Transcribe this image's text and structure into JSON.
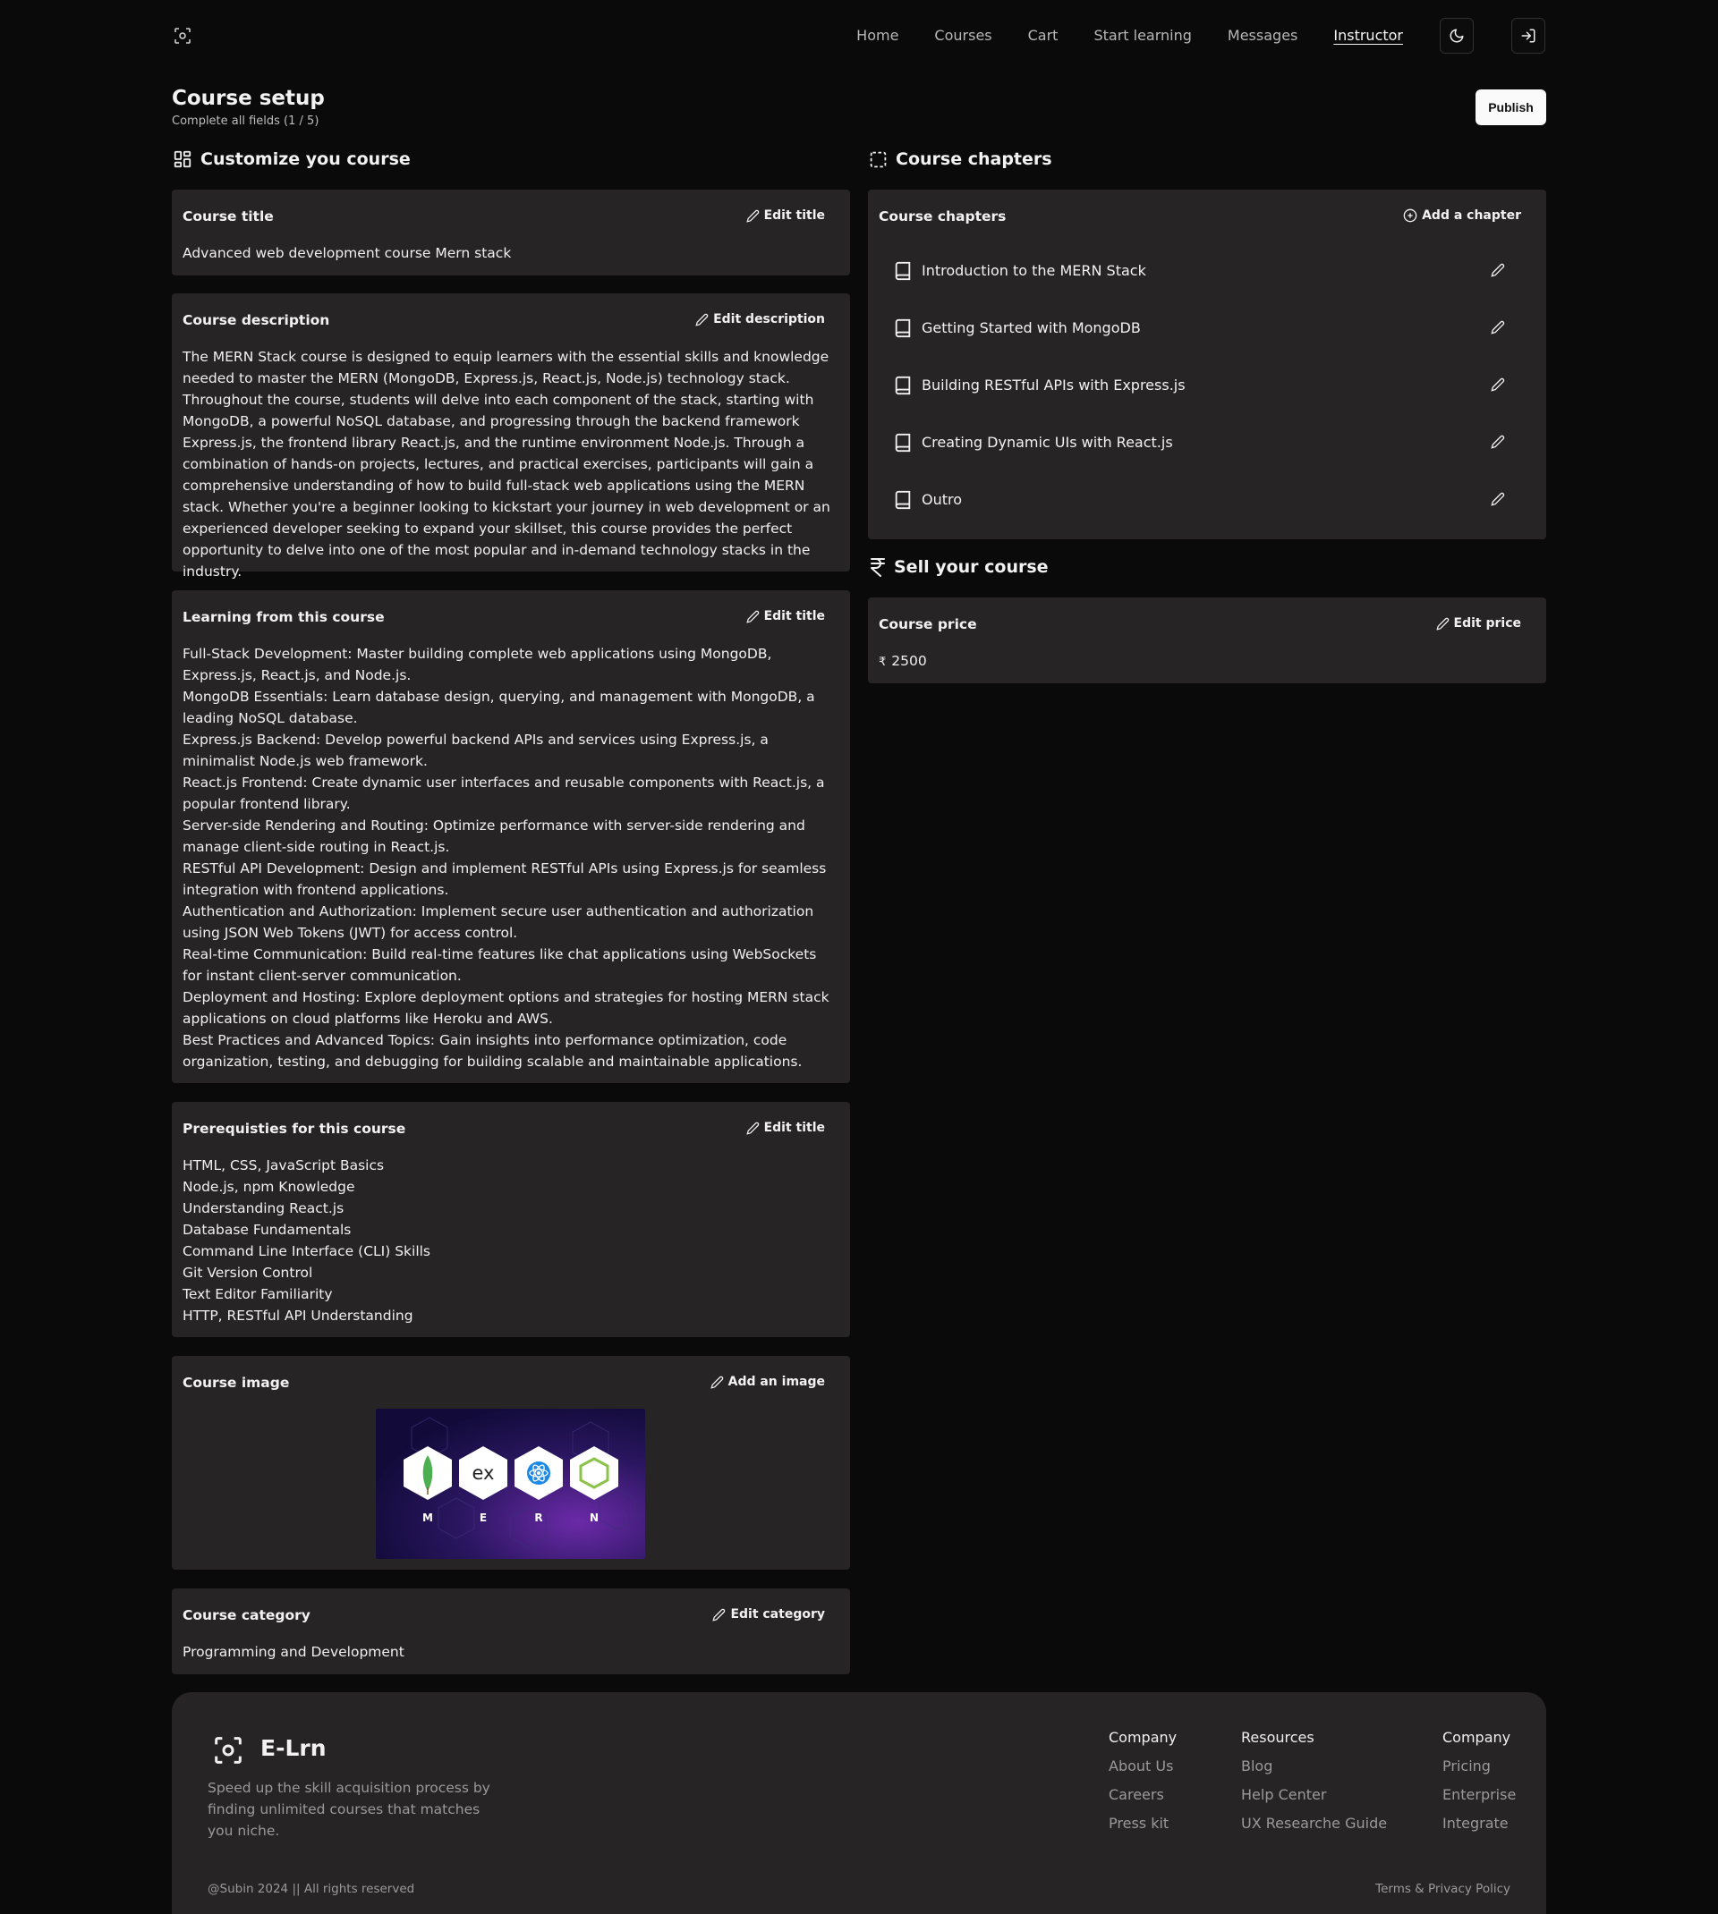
{
  "nav": {
    "links": [
      "Home",
      "Courses",
      "Cart",
      "Start learning",
      "Messages",
      "Instructor"
    ],
    "active": "Instructor"
  },
  "header": {
    "title": "Course setup",
    "subtitle": "Complete all fields (1 / 5)",
    "publish_label": "Publish"
  },
  "left": {
    "section_title": "Customize you course",
    "title_card": {
      "label": "Course title",
      "action": "Edit title",
      "value": "Advanced web development course Mern stack"
    },
    "description_card": {
      "label": "Course description",
      "action": "Edit description",
      "value": "The MERN Stack course is designed to equip learners with the essential skills and knowledge needed to master the MERN (MongoDB, Express.js, React.js, Node.js) technology stack. Throughout the course, students will delve into each component of the stack, starting with MongoDB, a powerful NoSQL database, and progressing through the backend framework Express.js, the frontend library React.js, and the runtime environment Node.js. Through a combination of hands-on projects, lectures, and practical exercises, participants will gain a comprehensive understanding of how to build full-stack web applications using the MERN stack. Whether you're a beginner looking to kickstart your journey in web development or an experienced developer seeking to expand your skillset, this course provides the perfect opportunity to delve into one of the most popular and in-demand technology stacks in the industry."
    },
    "learning_card": {
      "label": "Learning from this course",
      "action": "Edit title",
      "items": [
        "Full-Stack Development: Master building complete web applications using MongoDB, Express.js, React.js, and Node.js.",
        "MongoDB Essentials: Learn database design, querying, and management with MongoDB, a leading NoSQL database.",
        "Express.js Backend: Develop powerful backend APIs and services using Express.js, a minimalist Node.js web framework.",
        "React.js Frontend: Create dynamic user interfaces and reusable components with React.js, a popular frontend library.",
        "Server-side Rendering and Routing: Optimize performance with server-side rendering and manage client-side routing in React.js.",
        "RESTful API Development: Design and implement RESTful APIs using Express.js for seamless integration with frontend applications.",
        "Authentication and Authorization: Implement secure user authentication and authorization using JSON Web Tokens (JWT) for access control.",
        "Real-time Communication: Build real-time features like chat applications using WebSockets for instant client-server communication.",
        "Deployment and Hosting: Explore deployment options and strategies for hosting MERN stack applications on cloud platforms like Heroku and AWS.",
        "Best Practices and Advanced Topics: Gain insights into performance optimization, code organization, testing, and debugging for building scalable and maintainable applications."
      ]
    },
    "prereq_card": {
      "label": "Prerequisties for this course",
      "action": "Edit title",
      "items": [
        "HTML, CSS, JavaScript Basics",
        "Node.js, npm Knowledge",
        "Understanding React.js",
        "Database Fundamentals",
        "Command Line Interface (CLI) Skills",
        "Git Version Control",
        "Text Editor Familiarity",
        "HTTP, RESTful API Understanding"
      ]
    },
    "image_card": {
      "label": "Course image",
      "action": "Add an image",
      "letters": [
        "M",
        "E",
        "R",
        "N"
      ],
      "ex_text": "ex"
    },
    "category_card": {
      "label": "Course category",
      "action": "Edit category",
      "value": "Programming and Development"
    }
  },
  "right": {
    "chapters_section_title": "Course chapters",
    "chapters_card": {
      "label": "Course chapters",
      "action": "Add a chapter",
      "chapters": [
        "Introduction to the MERN Stack",
        "Getting Started with MongoDB",
        "Building RESTful APIs with Express.js",
        "Creating Dynamic UIs with React.js",
        "Outro"
      ]
    },
    "sell_section_title": "Sell your course",
    "price_card": {
      "label": "Course price",
      "action": "Edit price",
      "currency": "₹",
      "value": "2500"
    }
  },
  "footer": {
    "brand": "E-Lrn",
    "tagline": "Speed up the skill acquisition process by finding unlimited courses that matches you niche.",
    "columns": [
      {
        "heading": "Company",
        "links": [
          "About Us",
          "Careers",
          "Press kit"
        ]
      },
      {
        "heading": "Resources",
        "links": [
          "Blog",
          "Help Center",
          "UX Researche Guide"
        ]
      },
      {
        "heading": "Company",
        "links": [
          "Pricing",
          "Enterprise",
          "Integrate"
        ]
      }
    ],
    "copyright": "@Subin 2024 || All rights reserved",
    "terms": "Terms & Privacy Policy"
  },
  "colors": {
    "background": "#0a0a0a",
    "card": "#262425",
    "text": "#f2f2f2",
    "muted": "#9a9a9a"
  }
}
